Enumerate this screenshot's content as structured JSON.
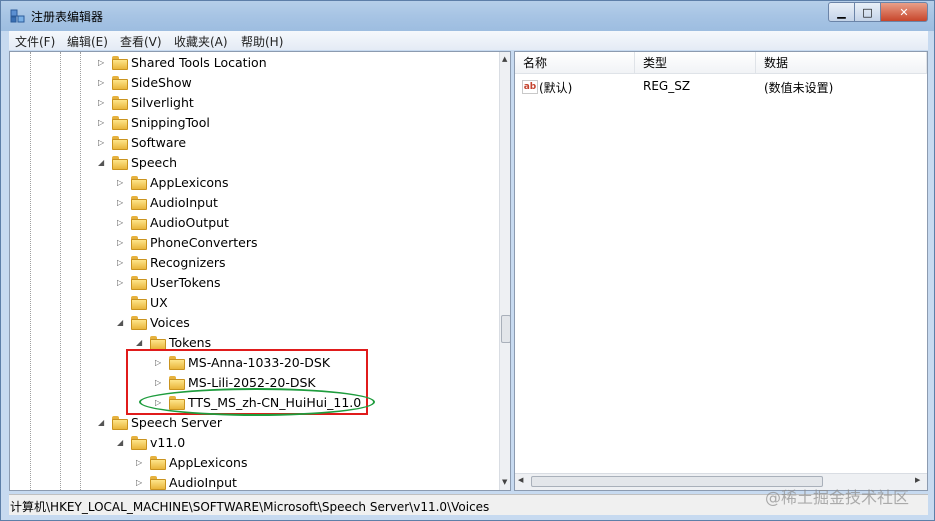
{
  "window": {
    "title": "注册表编辑器"
  },
  "menu": [
    "文件(F)",
    "编辑(E)",
    "查看(V)",
    "收藏夹(A)",
    "帮助(H)"
  ],
  "tree": [
    {
      "label": "Shared Tools Location",
      "depth": 0,
      "expander": "collapsed"
    },
    {
      "label": "SideShow",
      "depth": 0,
      "expander": "collapsed"
    },
    {
      "label": "Silverlight",
      "depth": 0,
      "expander": "collapsed"
    },
    {
      "label": "SnippingTool",
      "depth": 0,
      "expander": "collapsed"
    },
    {
      "label": "Software",
      "depth": 0,
      "expander": "collapsed"
    },
    {
      "label": "Speech",
      "depth": 0,
      "expander": "expanded"
    },
    {
      "label": "AppLexicons",
      "depth": 1,
      "expander": "collapsed"
    },
    {
      "label": "AudioInput",
      "depth": 1,
      "expander": "collapsed"
    },
    {
      "label": "AudioOutput",
      "depth": 1,
      "expander": "collapsed"
    },
    {
      "label": "PhoneConverters",
      "depth": 1,
      "expander": "collapsed"
    },
    {
      "label": "Recognizers",
      "depth": 1,
      "expander": "collapsed"
    },
    {
      "label": "UserTokens",
      "depth": 1,
      "expander": "collapsed"
    },
    {
      "label": "UX",
      "depth": 1,
      "expander": "none"
    },
    {
      "label": "Voices",
      "depth": 1,
      "expander": "expanded"
    },
    {
      "label": "Tokens",
      "depth": 2,
      "expander": "expanded"
    },
    {
      "label": "MS-Anna-1033-20-DSK",
      "depth": 3,
      "expander": "collapsed"
    },
    {
      "label": "MS-Lili-2052-20-DSK",
      "depth": 3,
      "expander": "collapsed"
    },
    {
      "label": "TTS_MS_zh-CN_HuiHui_11.0",
      "depth": 3,
      "expander": "collapsed"
    },
    {
      "label": "Speech Server",
      "depth": 0,
      "expander": "expanded"
    },
    {
      "label": "v11.0",
      "depth": 1,
      "expander": "expanded"
    },
    {
      "label": "AppLexicons",
      "depth": 2,
      "expander": "collapsed"
    },
    {
      "label": "AudioInput",
      "depth": 2,
      "expander": "collapsed"
    }
  ],
  "list": {
    "headers": [
      "名称",
      "类型",
      "数据"
    ],
    "rows": [
      {
        "name": "(默认)",
        "type": "REG_SZ",
        "data": "(数值未设置)"
      }
    ]
  },
  "status": "计算机\\HKEY_LOCAL_MACHINE\\SOFTWARE\\Microsoft\\Speech Server\\v11.0\\Voices",
  "watermark": "@稀土掘金技术社区",
  "icons": {
    "expand_collapsed": "▷",
    "expand_expanded": "◢",
    "scroll_up": "▲",
    "scroll_down": "▼",
    "scroll_left": "◀",
    "scroll_right": "▶",
    "string_value": "ab"
  },
  "colors": {
    "annotation_red": "#e01b1b",
    "annotation_green": "#1e9c3d",
    "title_gradient": "#a7c4e4",
    "close_button": "#c7462b"
  }
}
